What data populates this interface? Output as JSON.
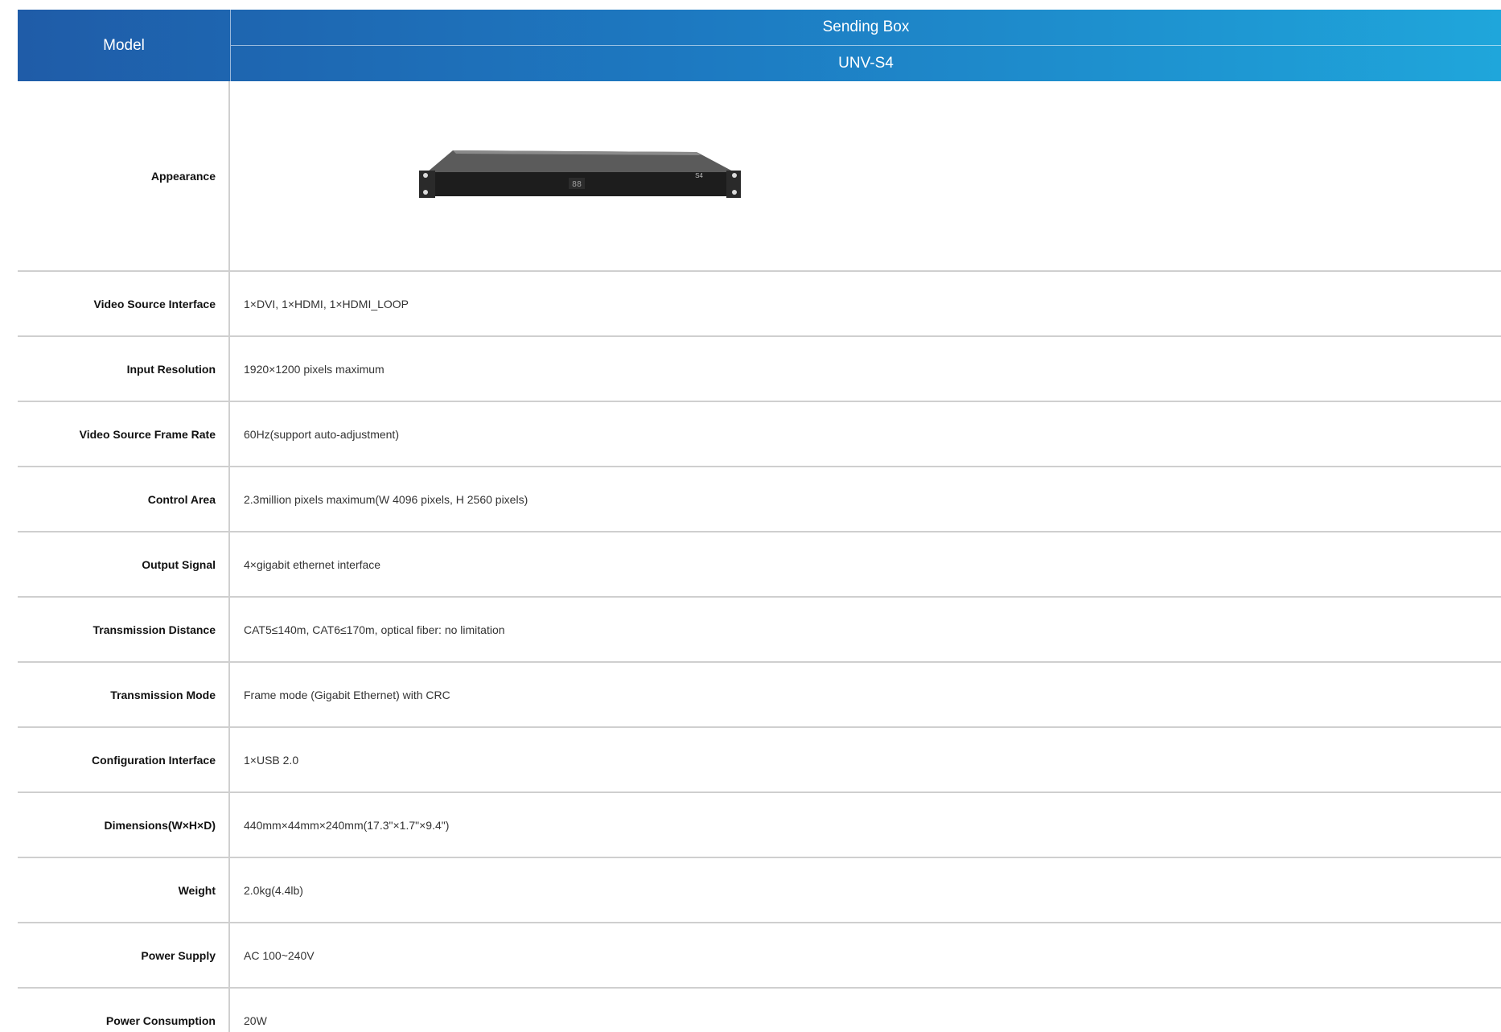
{
  "header": {
    "model_label": "Model",
    "product_type": "Sending Box",
    "model_name": "UNV-S4"
  },
  "appearance": {
    "label": "Appearance",
    "device_badge": "S4",
    "device_display": "88"
  },
  "specs": [
    {
      "label": "Video Source Interface",
      "value": "1×DVI, 1×HDMI, 1×HDMI_LOOP"
    },
    {
      "label": "Input Resolution",
      "value": "1920×1200 pixels maximum"
    },
    {
      "label": "Video Source Frame Rate",
      "value": "60Hz(support auto-adjustment)"
    },
    {
      "label": "Control Area",
      "value": "2.3million pixels maximum(W 4096 pixels, H 2560 pixels)"
    },
    {
      "label": "Output Signal",
      "value": "4×gigabit ethernet interface"
    },
    {
      "label": "Transmission Distance",
      "value": "CAT5≤140m, CAT6≤170m, optical fiber: no limitation"
    },
    {
      "label": "Transmission Mode",
      "value": "Frame mode (Gigabit Ethernet) with CRC"
    },
    {
      "label": "Configuration Interface",
      "value": "1×USB 2.0"
    },
    {
      "label": "Dimensions(W×H×D)",
      "value": "440mm×44mm×240mm(17.3\"×1.7\"×9.4\")"
    },
    {
      "label": "Weight",
      "value": "2.0kg(4.4lb)"
    },
    {
      "label": "Power Supply",
      "value": "AC 100~240V"
    },
    {
      "label": "Power Consumption",
      "value": "20W"
    }
  ]
}
